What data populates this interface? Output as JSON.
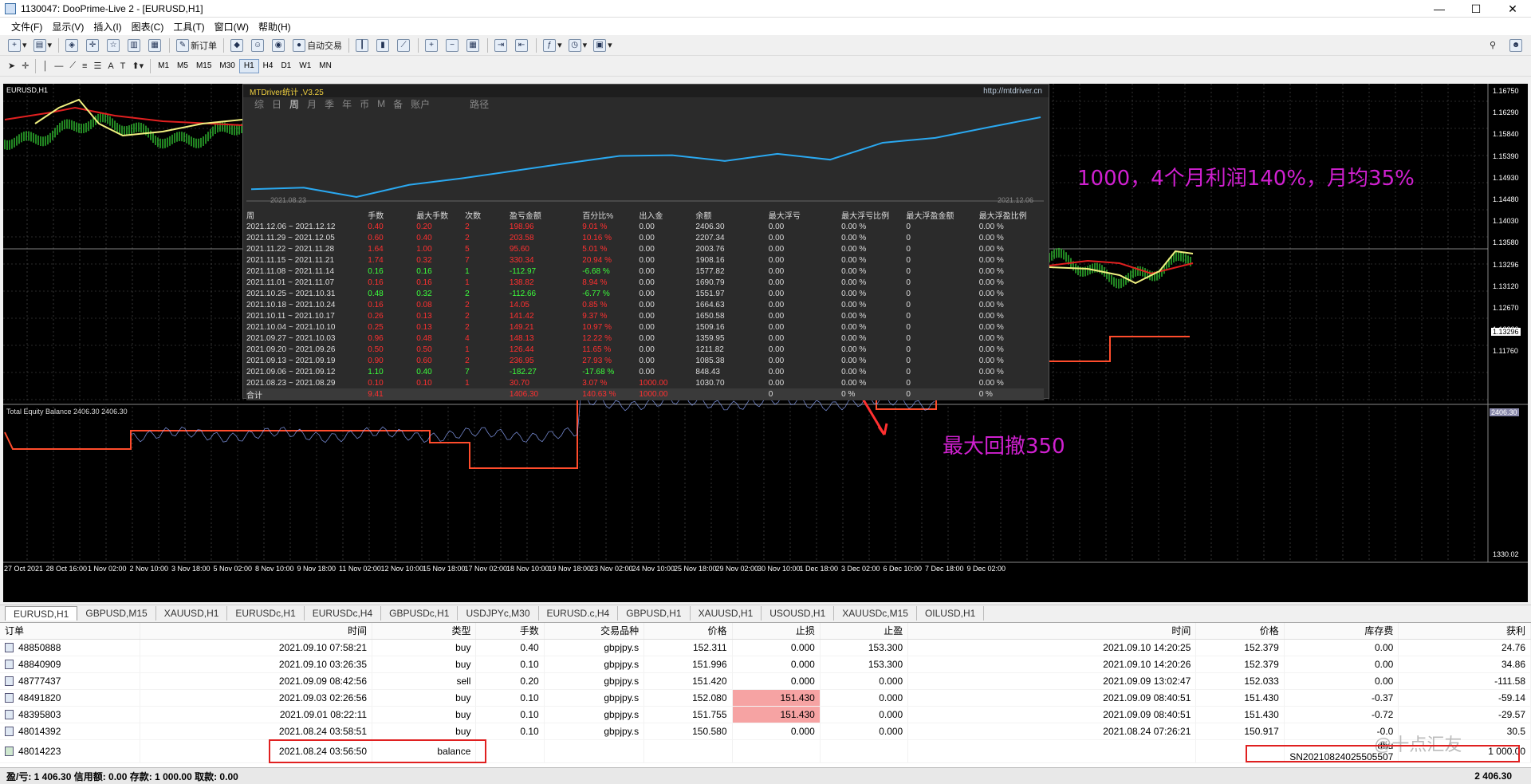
{
  "window": {
    "title": "1130047: DooPrime-Live 2 - [EURUSD,H1]",
    "controls": [
      "—",
      "☐",
      "✕"
    ]
  },
  "menu": [
    "文件(F)",
    "显示(V)",
    "插入(I)",
    "图表(C)",
    "工具(T)",
    "窗口(W)",
    "帮助(H)"
  ],
  "toolbar": {
    "new_order": "新订单",
    "auto_trade": "自动交易"
  },
  "timeframes": [
    "M1",
    "M5",
    "M15",
    "M30",
    "H1",
    "H4",
    "D1",
    "W1",
    "MN"
  ],
  "active_timeframe": "H1",
  "chart": {
    "symbol_label": "EURUSD,H1",
    "price_axis": [
      "1.16750",
      "1.16290",
      "1.15840",
      "1.15390",
      "1.14930",
      "1.14480",
      "1.14030",
      "1.13580",
      "1.13296",
      "1.13120",
      "1.12670",
      "1.12220",
      "1.11760"
    ],
    "current_price": "1.13296",
    "equity_label": "Total Equity Balance 2406.30 2406.30",
    "equity_axis": [
      "2406.30",
      "1330.02"
    ],
    "time_axis": [
      "27 Oct 2021",
      "28 Oct 16:00",
      "1 Nov 02:00",
      "2 Nov 10:00",
      "3 Nov 18:00",
      "5 Nov 02:00",
      "8 Nov 10:00",
      "9 Nov 18:00",
      "11 Nov 02:00",
      "12 Nov 10:00",
      "15 Nov 18:00",
      "17 Nov 02:00",
      "18 Nov 10:00",
      "19 Nov 18:00",
      "23 Nov 02:00",
      "24 Nov 10:00",
      "25 Nov 18:00",
      "29 Nov 02:00",
      "30 Nov 10:00",
      "1 Dec 18:00",
      "3 Dec 02:00",
      "6 Dec 10:00",
      "7 Dec 18:00",
      "9 Dec 02:00"
    ],
    "annotation_profit": "1000，4个月利润140%，月均35%",
    "annotation_drawdown": "最大回撤350"
  },
  "mtdriver": {
    "title": "MTDriver统计 ,V3.25",
    "url": "http://mtdriver.cn",
    "nav": [
      "综",
      "日",
      "周",
      "月",
      "季",
      "年",
      "币",
      "M",
      "备",
      "账户",
      "路径"
    ],
    "nav_active": "周",
    "curve_start": "2021.08.23",
    "curve_end": "2021.12.06",
    "columns": [
      "周",
      "手数",
      "最大手数",
      "次数",
      "盈亏金额",
      "百分比%",
      "出入金",
      "余额",
      "最大浮亏",
      "最大浮亏比例",
      "最大浮盈金额",
      "最大浮盈比例"
    ],
    "rows": [
      [
        "2021.12.06 ~ 2021.12.12",
        "0.40",
        "0.20",
        "2",
        "198.96",
        "9.01 %",
        "0.00",
        "2406.30",
        "0.00",
        "0.00 %",
        "0",
        "0.00 %"
      ],
      [
        "2021.11.29 ~ 2021.12.05",
        "0.60",
        "0.40",
        "2",
        "203.58",
        "10.16 %",
        "0.00",
        "2207.34",
        "0.00",
        "0.00 %",
        "0",
        "0.00 %"
      ],
      [
        "2021.11.22 ~ 2021.11.28",
        "1.64",
        "1.00",
        "5",
        "95.60",
        "5.01 %",
        "0.00",
        "2003.76",
        "0.00",
        "0.00 %",
        "0",
        "0.00 %"
      ],
      [
        "2021.11.15 ~ 2021.11.21",
        "1.74",
        "0.32",
        "7",
        "330.34",
        "20.94 %",
        "0.00",
        "1908.16",
        "0.00",
        "0.00 %",
        "0",
        "0.00 %"
      ],
      [
        "2021.11.08 ~ 2021.11.14",
        "0.16",
        "0.16",
        "1",
        "-112.97",
        "-6.68 %",
        "0.00",
        "1577.82",
        "0.00",
        "0.00 %",
        "0",
        "0.00 %"
      ],
      [
        "2021.11.01 ~ 2021.11.07",
        "0.16",
        "0.16",
        "1",
        "138.82",
        "8.94 %",
        "0.00",
        "1690.79",
        "0.00",
        "0.00 %",
        "0",
        "0.00 %"
      ],
      [
        "2021.10.25 ~ 2021.10.31",
        "0.48",
        "0.32",
        "2",
        "-112.66",
        "-6.77 %",
        "0.00",
        "1551.97",
        "0.00",
        "0.00 %",
        "0",
        "0.00 %"
      ],
      [
        "2021.10.18 ~ 2021.10.24",
        "0.16",
        "0.08",
        "2",
        "14.05",
        "0.85 %",
        "0.00",
        "1664.63",
        "0.00",
        "0.00 %",
        "0",
        "0.00 %"
      ],
      [
        "2021.10.11 ~ 2021.10.17",
        "0.26",
        "0.13",
        "2",
        "141.42",
        "9.37 %",
        "0.00",
        "1650.58",
        "0.00",
        "0.00 %",
        "0",
        "0.00 %"
      ],
      [
        "2021.10.04 ~ 2021.10.10",
        "0.25",
        "0.13",
        "2",
        "149.21",
        "10.97 %",
        "0.00",
        "1509.16",
        "0.00",
        "0.00 %",
        "0",
        "0.00 %"
      ],
      [
        "2021.09.27 ~ 2021.10.03",
        "0.96",
        "0.48",
        "4",
        "148.13",
        "12.22 %",
        "0.00",
        "1359.95",
        "0.00",
        "0.00 %",
        "0",
        "0.00 %"
      ],
      [
        "2021.09.20 ~ 2021.09.26",
        "0.50",
        "0.50",
        "1",
        "126.44",
        "11.65 %",
        "0.00",
        "1211.82",
        "0.00",
        "0.00 %",
        "0",
        "0.00 %"
      ],
      [
        "2021.09.13 ~ 2021.09.19",
        "0.90",
        "0.60",
        "2",
        "236.95",
        "27.93 %",
        "0.00",
        "1085.38",
        "0.00",
        "0.00 %",
        "0",
        "0.00 %"
      ],
      [
        "2021.09.06 ~ 2021.09.12",
        "1.10",
        "0.40",
        "7",
        "-182.27",
        "-17.68 %",
        "0.00",
        "848.43",
        "0.00",
        "0.00 %",
        "0",
        "0.00 %"
      ],
      [
        "2021.08.23 ~ 2021.08.29",
        "0.10",
        "0.10",
        "1",
        "30.70",
        "3.07 %",
        "1000.00",
        "1030.70",
        "0.00",
        "0.00 %",
        "0",
        "0.00 %"
      ]
    ],
    "total": [
      "合计",
      "9.41",
      "",
      "",
      "1406.30",
      "140.63 %",
      "1000.00",
      "",
      "0",
      "0 %",
      "0",
      "0 %"
    ]
  },
  "symbol_tabs": [
    "EURUSD,H1",
    "GBPUSD,M15",
    "XAUUSD,H1",
    "EURUSDc,H1",
    "EURUSDc,H4",
    "GBPUSDc,H1",
    "USDJPYc,M30",
    "EURUSD.c,H4",
    "GBPUSD,H1",
    "XAUUSD,H1",
    "USOUSD,H1",
    "XAUUSDc,M15",
    "OILUSD,H1"
  ],
  "active_symbol_tab": "EURUSD,H1",
  "terminal": {
    "columns": [
      "订单",
      "时间",
      "类型",
      "手数",
      "交易品种",
      "价格",
      "止损",
      "止盈",
      "时间",
      "价格",
      "库存费",
      "获利"
    ],
    "rows": [
      [
        "48850888",
        "2021.09.10 07:58:21",
        "buy",
        "0.40",
        "gbpjpy.s",
        "152.311",
        "0.000",
        "153.300",
        "2021.09.10 14:20:25",
        "152.379",
        "0.00",
        "24.76"
      ],
      [
        "48840909",
        "2021.09.10 03:26:35",
        "buy",
        "0.10",
        "gbpjpy.s",
        "151.996",
        "0.000",
        "153.300",
        "2021.09.10 14:20:26",
        "152.379",
        "0.00",
        "34.86"
      ],
      [
        "48777437",
        "2021.09.09 08:42:56",
        "sell",
        "0.20",
        "gbpjpy.s",
        "151.420",
        "0.000",
        "0.000",
        "2021.09.09 13:02:47",
        "152.033",
        "0.00",
        "-111.58"
      ],
      [
        "48491820",
        "2021.09.03 02:26:56",
        "buy",
        "0.10",
        "gbpjpy.s",
        "152.080",
        "151.430",
        "0.000",
        "2021.09.09 08:40:51",
        "151.430",
        "-0.37",
        "-59.14"
      ],
      [
        "48395803",
        "2021.09.01 08:22:11",
        "buy",
        "0.10",
        "gbpjpy.s",
        "151.755",
        "151.430",
        "0.000",
        "2021.09.09 08:40:51",
        "151.430",
        "-0.72",
        "-29.57"
      ],
      [
        "48014392",
        "2021.08.24 03:58:51",
        "buy",
        "0.10",
        "gbpjpy.s",
        "150.580",
        "0.000",
        "0.000",
        "2021.08.24 07:26:21",
        "150.917",
        "-0.0",
        "30.5"
      ]
    ],
    "balance_row": {
      "order": "48014223",
      "time": "2021.08.24 03:56:50",
      "type": "balance",
      "comment": "dbu SN20210824025505507",
      "profit": "1 000.00"
    },
    "footer": "盈/亏: 1 406.30  信用额: 0.00  存款: 1 000.00  取款: 0.00",
    "footer_total": "2 406.30",
    "watermark": "@十点汇友"
  },
  "colors": {
    "sl_highlight": "#f6a3a3",
    "balance_line": "#ff4c2c",
    "equity_line": "#8ea8ff",
    "ma_red": "#e02020",
    "ma_yellow": "#f0f080",
    "candle_green": "#30c030",
    "annotation": "#d020d0"
  }
}
